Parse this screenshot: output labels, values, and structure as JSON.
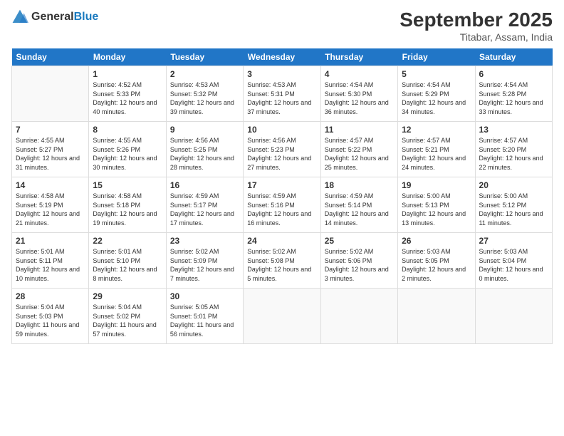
{
  "header": {
    "logo_general": "General",
    "logo_blue": "Blue",
    "month_title": "September 2025",
    "location": "Titabar, Assam, India"
  },
  "days_of_week": [
    "Sunday",
    "Monday",
    "Tuesday",
    "Wednesday",
    "Thursday",
    "Friday",
    "Saturday"
  ],
  "weeks": [
    [
      {
        "day": "",
        "sunrise": "",
        "sunset": "",
        "daylight": ""
      },
      {
        "day": "1",
        "sunrise": "Sunrise: 4:52 AM",
        "sunset": "Sunset: 5:33 PM",
        "daylight": "Daylight: 12 hours and 40 minutes."
      },
      {
        "day": "2",
        "sunrise": "Sunrise: 4:53 AM",
        "sunset": "Sunset: 5:32 PM",
        "daylight": "Daylight: 12 hours and 39 minutes."
      },
      {
        "day": "3",
        "sunrise": "Sunrise: 4:53 AM",
        "sunset": "Sunset: 5:31 PM",
        "daylight": "Daylight: 12 hours and 37 minutes."
      },
      {
        "day": "4",
        "sunrise": "Sunrise: 4:54 AM",
        "sunset": "Sunset: 5:30 PM",
        "daylight": "Daylight: 12 hours and 36 minutes."
      },
      {
        "day": "5",
        "sunrise": "Sunrise: 4:54 AM",
        "sunset": "Sunset: 5:29 PM",
        "daylight": "Daylight: 12 hours and 34 minutes."
      },
      {
        "day": "6",
        "sunrise": "Sunrise: 4:54 AM",
        "sunset": "Sunset: 5:28 PM",
        "daylight": "Daylight: 12 hours and 33 minutes."
      }
    ],
    [
      {
        "day": "7",
        "sunrise": "Sunrise: 4:55 AM",
        "sunset": "Sunset: 5:27 PM",
        "daylight": "Daylight: 12 hours and 31 minutes."
      },
      {
        "day": "8",
        "sunrise": "Sunrise: 4:55 AM",
        "sunset": "Sunset: 5:26 PM",
        "daylight": "Daylight: 12 hours and 30 minutes."
      },
      {
        "day": "9",
        "sunrise": "Sunrise: 4:56 AM",
        "sunset": "Sunset: 5:25 PM",
        "daylight": "Daylight: 12 hours and 28 minutes."
      },
      {
        "day": "10",
        "sunrise": "Sunrise: 4:56 AM",
        "sunset": "Sunset: 5:23 PM",
        "daylight": "Daylight: 12 hours and 27 minutes."
      },
      {
        "day": "11",
        "sunrise": "Sunrise: 4:57 AM",
        "sunset": "Sunset: 5:22 PM",
        "daylight": "Daylight: 12 hours and 25 minutes."
      },
      {
        "day": "12",
        "sunrise": "Sunrise: 4:57 AM",
        "sunset": "Sunset: 5:21 PM",
        "daylight": "Daylight: 12 hours and 24 minutes."
      },
      {
        "day": "13",
        "sunrise": "Sunrise: 4:57 AM",
        "sunset": "Sunset: 5:20 PM",
        "daylight": "Daylight: 12 hours and 22 minutes."
      }
    ],
    [
      {
        "day": "14",
        "sunrise": "Sunrise: 4:58 AM",
        "sunset": "Sunset: 5:19 PM",
        "daylight": "Daylight: 12 hours and 21 minutes."
      },
      {
        "day": "15",
        "sunrise": "Sunrise: 4:58 AM",
        "sunset": "Sunset: 5:18 PM",
        "daylight": "Daylight: 12 hours and 19 minutes."
      },
      {
        "day": "16",
        "sunrise": "Sunrise: 4:59 AM",
        "sunset": "Sunset: 5:17 PM",
        "daylight": "Daylight: 12 hours and 17 minutes."
      },
      {
        "day": "17",
        "sunrise": "Sunrise: 4:59 AM",
        "sunset": "Sunset: 5:16 PM",
        "daylight": "Daylight: 12 hours and 16 minutes."
      },
      {
        "day": "18",
        "sunrise": "Sunrise: 4:59 AM",
        "sunset": "Sunset: 5:14 PM",
        "daylight": "Daylight: 12 hours and 14 minutes."
      },
      {
        "day": "19",
        "sunrise": "Sunrise: 5:00 AM",
        "sunset": "Sunset: 5:13 PM",
        "daylight": "Daylight: 12 hours and 13 minutes."
      },
      {
        "day": "20",
        "sunrise": "Sunrise: 5:00 AM",
        "sunset": "Sunset: 5:12 PM",
        "daylight": "Daylight: 12 hours and 11 minutes."
      }
    ],
    [
      {
        "day": "21",
        "sunrise": "Sunrise: 5:01 AM",
        "sunset": "Sunset: 5:11 PM",
        "daylight": "Daylight: 12 hours and 10 minutes."
      },
      {
        "day": "22",
        "sunrise": "Sunrise: 5:01 AM",
        "sunset": "Sunset: 5:10 PM",
        "daylight": "Daylight: 12 hours and 8 minutes."
      },
      {
        "day": "23",
        "sunrise": "Sunrise: 5:02 AM",
        "sunset": "Sunset: 5:09 PM",
        "daylight": "Daylight: 12 hours and 7 minutes."
      },
      {
        "day": "24",
        "sunrise": "Sunrise: 5:02 AM",
        "sunset": "Sunset: 5:08 PM",
        "daylight": "Daylight: 12 hours and 5 minutes."
      },
      {
        "day": "25",
        "sunrise": "Sunrise: 5:02 AM",
        "sunset": "Sunset: 5:06 PM",
        "daylight": "Daylight: 12 hours and 3 minutes."
      },
      {
        "day": "26",
        "sunrise": "Sunrise: 5:03 AM",
        "sunset": "Sunset: 5:05 PM",
        "daylight": "Daylight: 12 hours and 2 minutes."
      },
      {
        "day": "27",
        "sunrise": "Sunrise: 5:03 AM",
        "sunset": "Sunset: 5:04 PM",
        "daylight": "Daylight: 12 hours and 0 minutes."
      }
    ],
    [
      {
        "day": "28",
        "sunrise": "Sunrise: 5:04 AM",
        "sunset": "Sunset: 5:03 PM",
        "daylight": "Daylight: 11 hours and 59 minutes."
      },
      {
        "day": "29",
        "sunrise": "Sunrise: 5:04 AM",
        "sunset": "Sunset: 5:02 PM",
        "daylight": "Daylight: 11 hours and 57 minutes."
      },
      {
        "day": "30",
        "sunrise": "Sunrise: 5:05 AM",
        "sunset": "Sunset: 5:01 PM",
        "daylight": "Daylight: 11 hours and 56 minutes."
      },
      {
        "day": "",
        "sunrise": "",
        "sunset": "",
        "daylight": ""
      },
      {
        "day": "",
        "sunrise": "",
        "sunset": "",
        "daylight": ""
      },
      {
        "day": "",
        "sunrise": "",
        "sunset": "",
        "daylight": ""
      },
      {
        "day": "",
        "sunrise": "",
        "sunset": "",
        "daylight": ""
      }
    ]
  ]
}
